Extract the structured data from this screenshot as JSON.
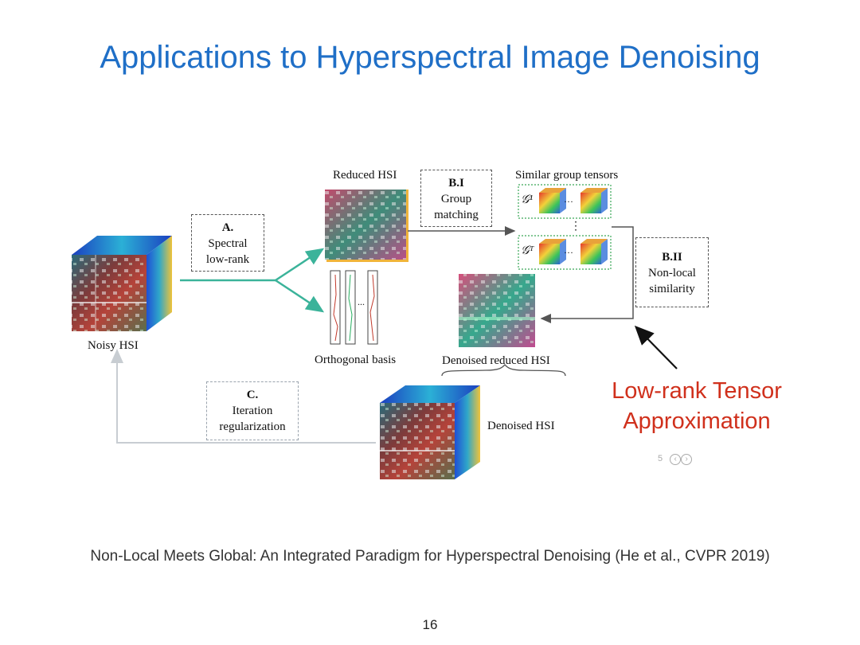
{
  "slide": {
    "title": "Applications to Hyperspectral Image Denoising",
    "citation": "Non-Local Meets Global: An Integrated Paradigm for Hyperspectral Denoising (He et al., CVPR 2019)",
    "page_number": "16"
  },
  "diagram": {
    "noisy_hsi": "Noisy HSI",
    "reduced_hsi": "Reduced HSI",
    "orthogonal_basis": "Orthogonal basis",
    "basis_dots": "...",
    "denoised_reduced_hsi": "Denoised reduced HSI",
    "denoised_hsi": "Denoised HSI",
    "similar_group_tensors": "Similar group tensors",
    "g1": "𝒢¹",
    "gT": "𝒢ᵀ",
    "dots_h": "···",
    "dots_v": "⋮",
    "box_a": {
      "id": "A.",
      "line1": "Spectral",
      "line2": "low-rank"
    },
    "box_bi": {
      "id": "B.I",
      "line1": "Group",
      "line2": "matching"
    },
    "box_bii": {
      "id": "B.II",
      "line1": "Non-local",
      "line2": "similarity"
    },
    "box_c": {
      "id": "C.",
      "line1": "Iteration",
      "line2": "regularization"
    }
  },
  "annotation": {
    "line1": "Low-rank Tensor",
    "line2": "Approximation",
    "mini_page": "5"
  },
  "colors": {
    "title": "#1f6fc7",
    "annotation": "#d0301c",
    "teal_arrow": "#3bb39a",
    "gray_arrow": "#555555",
    "feedback_arrow": "#c8cdd2"
  }
}
